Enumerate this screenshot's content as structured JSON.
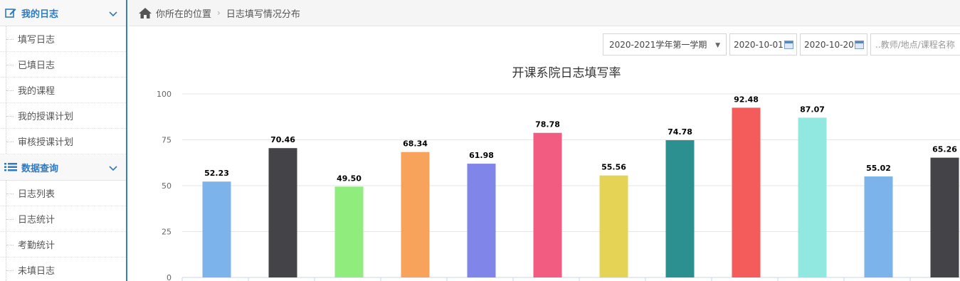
{
  "sidebar": {
    "sections": [
      {
        "title": "我的日志",
        "icon": "edit-icon",
        "items": [
          "填写日志",
          "已填日志",
          "我的课程",
          "我的授课计划",
          "审核授课计划"
        ]
      },
      {
        "title": "数据查询",
        "icon": "list-icon",
        "items": [
          "日志列表",
          "日志统计",
          "考勤统计",
          "未填日志"
        ]
      }
    ]
  },
  "breadcrumb": {
    "prefix": "你所在的位置",
    "current": "日志填写情况分布"
  },
  "filters": {
    "semester": "2020-2021学年第一学期",
    "start_date": "2020-10-01",
    "end_date": "2020-10-20",
    "search_placeholder": "..教师/地点/课程名称"
  },
  "chart_data": {
    "type": "bar",
    "title": "开课系院日志填写率",
    "ylim": [
      0,
      100
    ],
    "yticks": [
      0,
      25,
      50,
      75,
      100
    ],
    "grid": true,
    "values": [
      52.23,
      70.46,
      49.5,
      68.34,
      61.98,
      78.78,
      55.56,
      74.78,
      92.48,
      87.07,
      55.02,
      65.26
    ],
    "value_labels": [
      "52.23",
      "70.46",
      "49.50",
      "68.34",
      "61.98",
      "78.78",
      "55.56",
      "74.78",
      "92.48",
      "87.07",
      "55.02",
      "65.26"
    ],
    "colors": [
      "#7cb3ea",
      "#434348",
      "#90ed7d",
      "#f7a35c",
      "#8085e9",
      "#f15c80",
      "#e4d354",
      "#2b908f",
      "#f45b5b",
      "#91e8e1",
      "#7cb3ea",
      "#434348"
    ]
  }
}
